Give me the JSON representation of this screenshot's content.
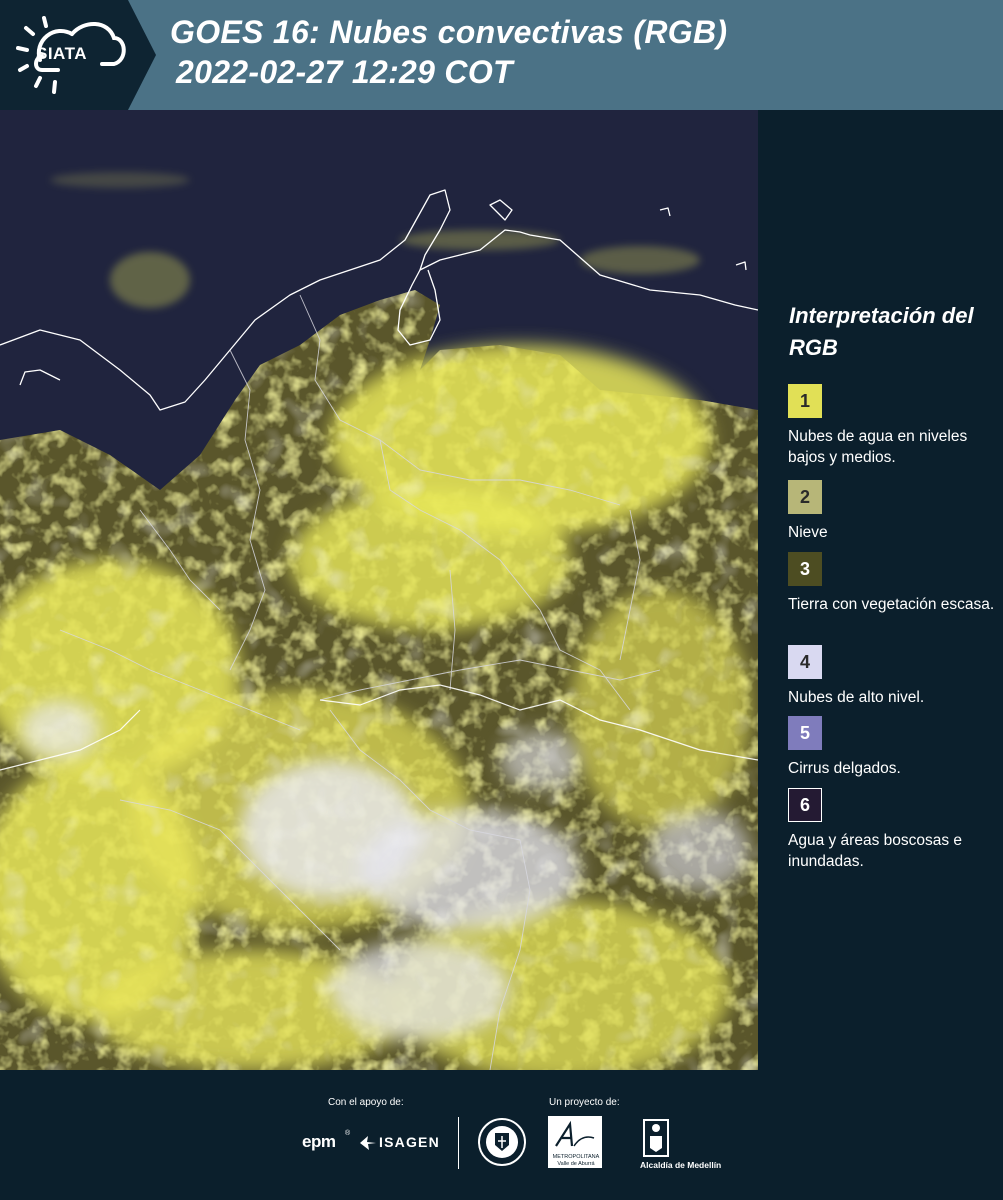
{
  "header": {
    "logo_text": "SIATA",
    "title_line1": "GOES 16: Nubes convectivas (RGB)",
    "title_line2": "2022-02-27 12:29 COT"
  },
  "map": {
    "background_color": "#20243e",
    "cloud_yellow": "#ecec5a",
    "cloud_white": "#e6e6ef",
    "vegetation_color": "#59552a",
    "border_color": "#d8d8e0",
    "coastline_color": "#ffffff"
  },
  "legend": {
    "title": "Interpretación del RGB",
    "items": [
      {
        "number": "1",
        "label": "Nubes de agua en niveles bajos y medios.",
        "color": "#e1e056",
        "text_color": "#2a2a2a"
      },
      {
        "number": "2",
        "label": "Nieve",
        "color": "#b7b678",
        "text_color": "#2a2a2a"
      },
      {
        "number": "3",
        "label": "Tierra con vegetación escasa.",
        "color": "#4d4d22",
        "text_color": "#ffffff"
      },
      {
        "number": "4",
        "label": "Nubes de alto nivel.",
        "color": "#d9d9f1",
        "text_color": "#2a2a2a"
      },
      {
        "number": "5",
        "label": "Cirrus delgados.",
        "color": "#7f7cbc",
        "text_color": "#ffffff"
      },
      {
        "number": "6",
        "label": "Agua y áreas boscosas e inundadas.",
        "color": "#241a33",
        "text_color": "#ffffff"
      }
    ]
  },
  "footer": {
    "support_label": "Con el apoyo de:",
    "project_label": "Un proyecto de:",
    "epm": "epm",
    "epm_reg": "®",
    "isagen": "ISAGEN",
    "area_name": "Área",
    "area_sub": "METROPOLITANA Valle de Aburrá",
    "alcaldia": "Alcaldía de Medellín"
  }
}
